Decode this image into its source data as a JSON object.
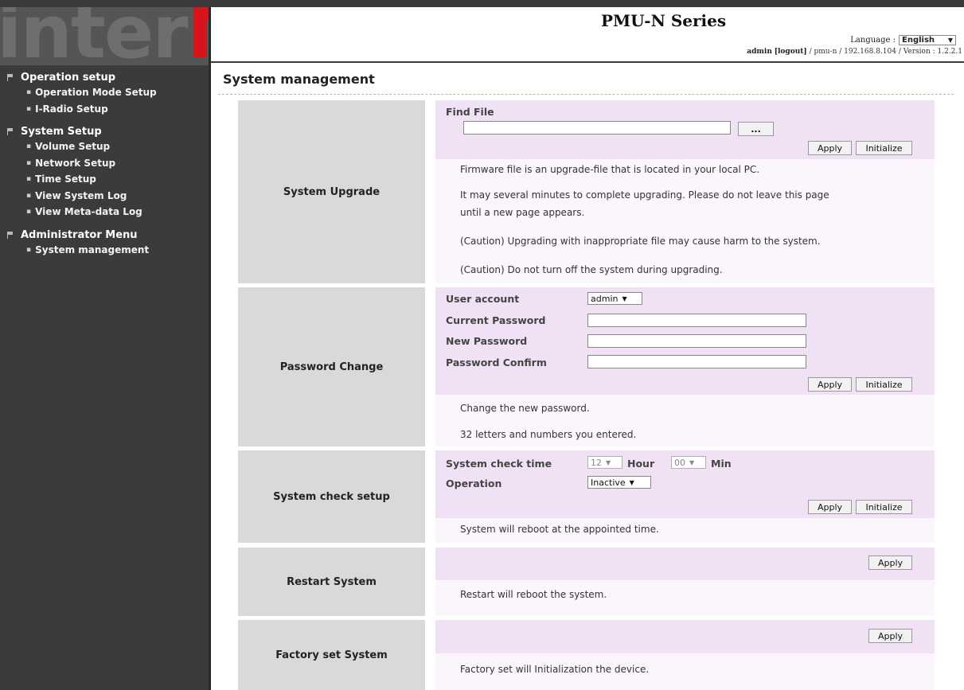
{
  "brand": {
    "logo_text_1": "inter",
    "logo_text_2": "M"
  },
  "header": {
    "title": "PMU-N Series",
    "language_label": "Language :",
    "language_value": "English",
    "user": "admin",
    "logout": "[logout]",
    "path": "/ pmu-n / 192.168.8.104 / Version : 1.2.2.1"
  },
  "sidebar": {
    "groups": [
      {
        "title": "Operation setup",
        "items": [
          "Operation Mode Setup",
          "I-Radio Setup"
        ]
      },
      {
        "title": "System Setup",
        "items": [
          "Volume Setup",
          "Network Setup",
          "Time Setup",
          "View System Log",
          "View Meta-data Log"
        ]
      },
      {
        "title": "Administrator Menu",
        "items": [
          "System management"
        ]
      }
    ]
  },
  "page": {
    "title": "System management"
  },
  "sections": {
    "upgrade": {
      "label": "System Upgrade",
      "find_file": "Find File",
      "file_value": "",
      "browse": "...",
      "apply": "Apply",
      "initialize": "Initialize",
      "notes": [
        "Firmware file is an upgrade-file that is located in your local PC.",
        "It may several minutes to complete upgrading. Please do not leave this page",
        "until a new page appears.",
        "(Caution) Upgrading with inappropriate file may cause harm to the system.",
        "(Caution) Do not turn off the system during upgrading."
      ]
    },
    "password": {
      "label": "Password Change",
      "user_account": "User account",
      "user_account_value": "admin",
      "current": "Current Password",
      "new": "New Password",
      "confirm": "Password Confirm",
      "apply": "Apply",
      "initialize": "Initialize",
      "notes": [
        "Change the new password.",
        "32 letters and numbers you entered."
      ]
    },
    "check": {
      "label": "System check setup",
      "time_label": "System check time",
      "hour_value": "12",
      "hour_unit": "Hour",
      "min_value": "00",
      "min_unit": "Min",
      "operation_label": "Operation",
      "operation_value": "Inactive",
      "apply": "Apply",
      "initialize": "Initialize",
      "note": "System will reboot at the appointed time."
    },
    "restart": {
      "label": "Restart System",
      "apply": "Apply",
      "note": "Restart will reboot the system."
    },
    "factory": {
      "label": "Factory set System",
      "apply": "Apply",
      "note": "Factory set will Initialization the device."
    }
  }
}
